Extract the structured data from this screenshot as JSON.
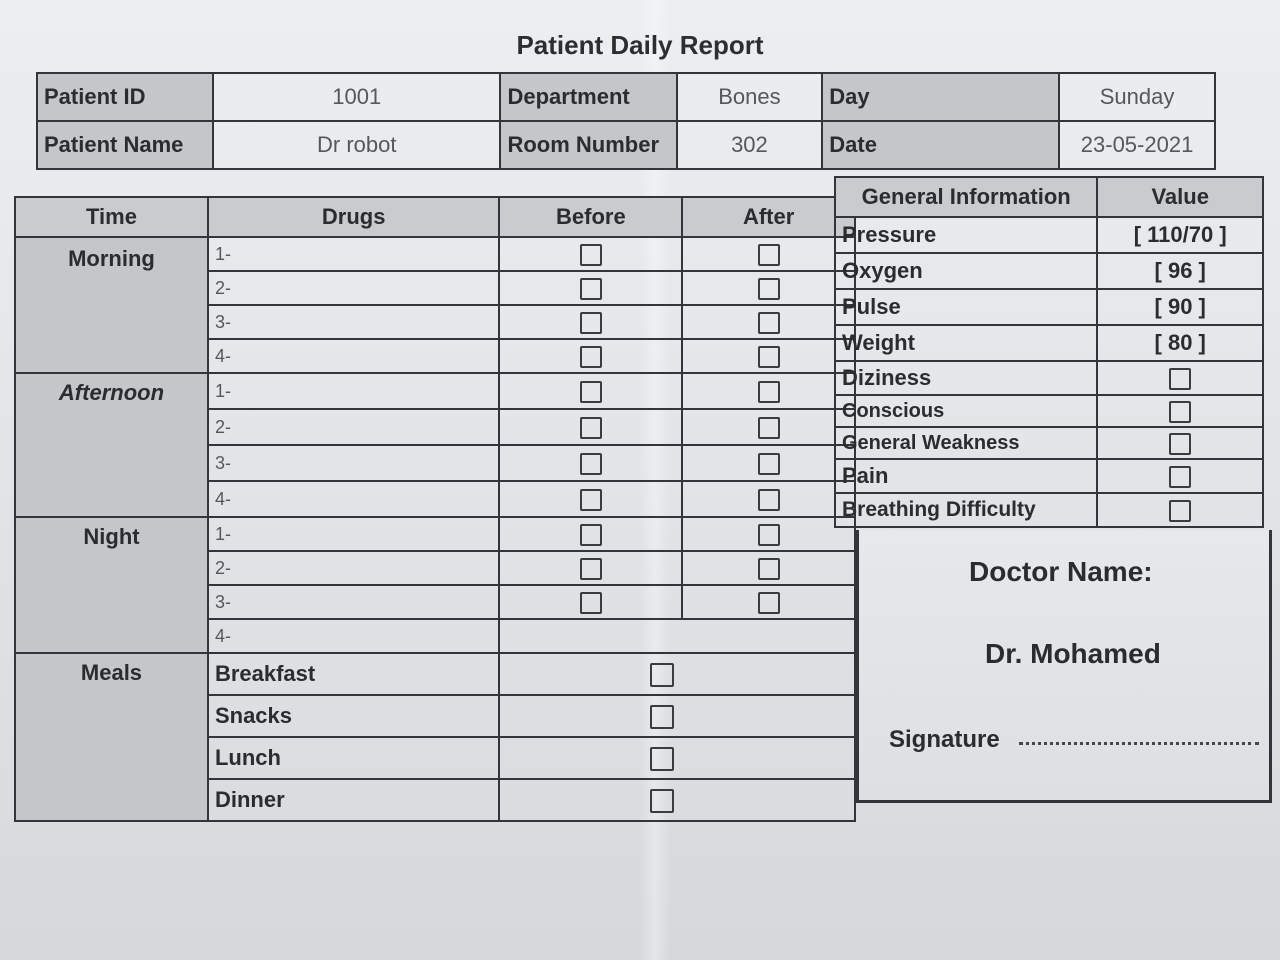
{
  "title": "Patient Daily Report",
  "info": {
    "patient_id_label": "Patient ID",
    "patient_id": "1001",
    "patient_name_label": "Patient Name",
    "patient_name": "Dr robot",
    "department_label": "Department",
    "department": "Bones",
    "room_label": "Room Number",
    "room": "302",
    "day_label": "Day",
    "day": "Sunday",
    "date_label": "Date",
    "date": "23-05-2021"
  },
  "drugs_table": {
    "headers": [
      "Time",
      "Drugs",
      "Before",
      "After"
    ],
    "periods": [
      {
        "label": "Morning",
        "rows": [
          "1-",
          "2-",
          "3-",
          "4-"
        ]
      },
      {
        "label": "Afternoon",
        "rows": [
          "1-",
          "2-",
          "3-",
          "4-"
        ]
      },
      {
        "label": "Night",
        "rows": [
          "1-",
          "2-",
          "3-",
          "4-"
        ]
      }
    ],
    "meals": {
      "label": "Meals",
      "rows": [
        "Breakfast",
        "Snacks",
        "Lunch",
        "Dinner"
      ]
    }
  },
  "general_info": {
    "headers": [
      "General Information",
      "Value"
    ],
    "rows": [
      {
        "label": "Pressure",
        "value": "[ 110/70 ]"
      },
      {
        "label": "Oxygen",
        "value": "[ 96 ]"
      },
      {
        "label": "Pulse",
        "value": "[ 90 ]"
      },
      {
        "label": "Weight",
        "value": "[ 80 ]"
      },
      {
        "label": "Diziness",
        "value": null
      },
      {
        "label": "Conscious",
        "value": null
      },
      {
        "label": "General Weakness",
        "value": null
      },
      {
        "label": "Pain",
        "value": null
      },
      {
        "label": "Breathing Difficulty",
        "value": null
      }
    ]
  },
  "doctor": {
    "label": "Doctor Name:",
    "name": "Dr. Mohamed",
    "signature_label": "Signature"
  }
}
